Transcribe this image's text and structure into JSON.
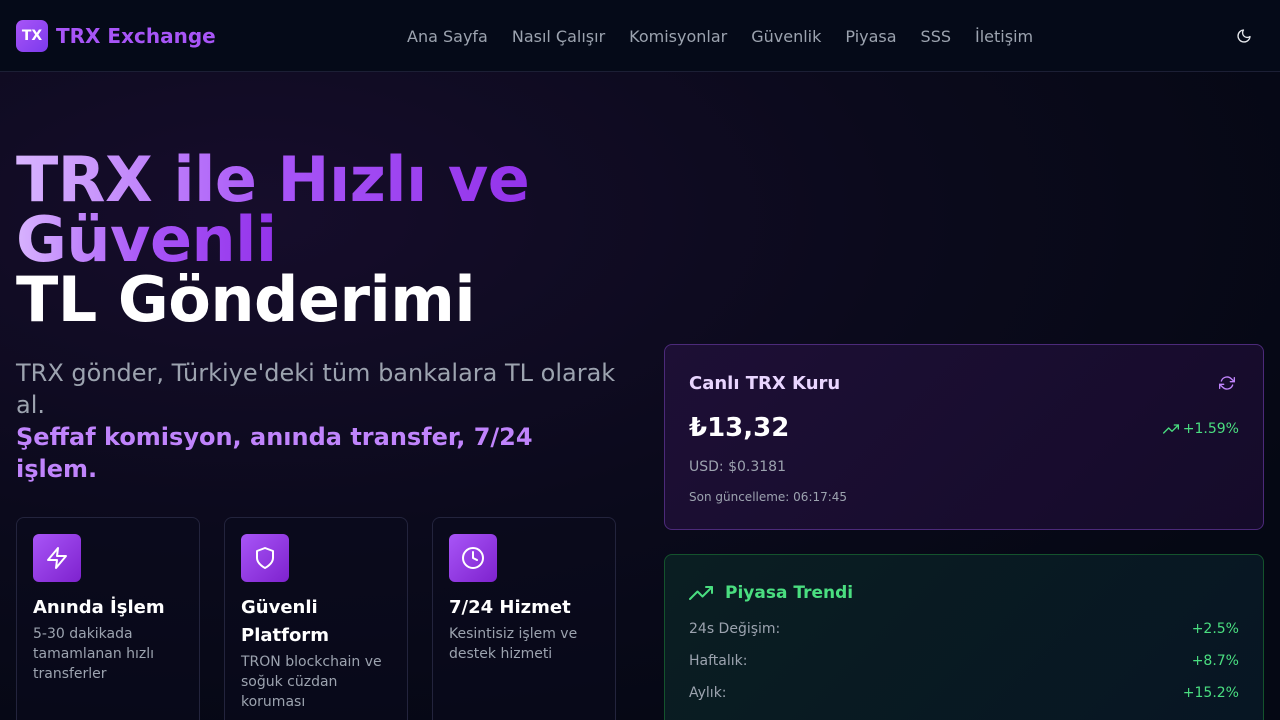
{
  "brand": {
    "logo_mark": "TX",
    "name": "TRX Exchange"
  },
  "nav": {
    "links": [
      "Ana Sayfa",
      "Nasıl Çalışır",
      "Komisyonlar",
      "Güvenlik",
      "Piyasa",
      "SSS",
      "İletişim"
    ],
    "theme_icon": "moon-icon"
  },
  "hero": {
    "title_line1": "TRX ile Hızlı ve",
    "title_line2": "Güvenli",
    "title_line3": "TL Gönderimi",
    "subtitle": "TRX gönder, Türkiye'deki tüm bankalara TL olarak al.",
    "highlight": "Şeffaf komisyon, anında transfer, 7/24 işlem."
  },
  "features": [
    {
      "icon": "lightning-icon",
      "title": "Anında İşlem",
      "desc": "5-30 dakikada tamamlanan hızlı transferler"
    },
    {
      "icon": "shield-icon",
      "title": "Güvenli Platform",
      "desc": "TRON blockchain ve soğuk cüzdan koruması"
    },
    {
      "icon": "clock-icon",
      "title": "7/24 Hizmet",
      "desc": "Kesintisiz işlem ve destek hizmeti"
    }
  ],
  "rate_card": {
    "title": "Canlı TRX Kuru",
    "price": "₺13,32",
    "change": "+1.59%",
    "usd": "USD: $0.3181",
    "updated": "Son güncelleme: 06:17:45"
  },
  "trend_card": {
    "title": "Piyasa Trendi",
    "rows": [
      {
        "label": "24s Değişim:",
        "value": "+2.5%"
      },
      {
        "label": "Haftalık:",
        "value": "+8.7%"
      },
      {
        "label": "Aylık:",
        "value": "+15.2%"
      }
    ]
  },
  "colors": {
    "accent": "#a855f7",
    "positive": "#4ade80",
    "background": "#0b0a1c"
  }
}
